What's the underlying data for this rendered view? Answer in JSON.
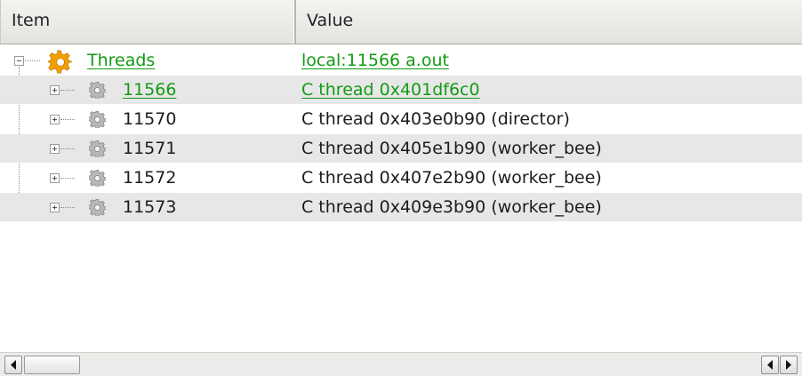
{
  "columns": {
    "item": "Item",
    "value": "Value"
  },
  "root": {
    "item": "Threads",
    "value": "local:11566 a.out",
    "icon": "gear-orange-icon",
    "expanded": true
  },
  "threads": [
    {
      "item": "11566",
      "value": "C thread 0x401df6c0",
      "highlight": true,
      "icon": "gear-gray-icon"
    },
    {
      "item": "11570",
      "value": "C thread 0x403e0b90 (director)",
      "highlight": false,
      "icon": "gear-gray-icon"
    },
    {
      "item": "11571",
      "value": "C thread 0x405e1b90 (worker_bee)",
      "highlight": false,
      "icon": "gear-gray-icon"
    },
    {
      "item": "11572",
      "value": "C thread 0x407e2b90 (worker_bee)",
      "highlight": false,
      "icon": "gear-gray-icon"
    },
    {
      "item": "11573",
      "value": "C thread 0x409e3b90 (worker_bee)",
      "highlight": false,
      "icon": "gear-gray-icon"
    }
  ],
  "colors": {
    "link_green": "#149b14",
    "alt_row": "#e7e7e7",
    "gear_orange": "#f2a000"
  }
}
